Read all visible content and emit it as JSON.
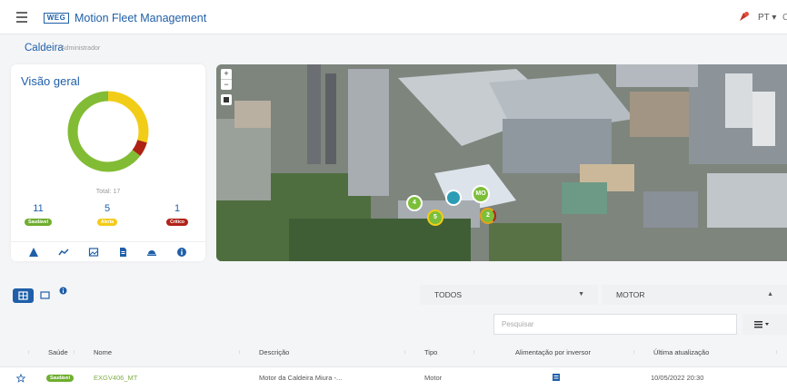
{
  "header": {
    "logo_text": "WEG",
    "title": "Motion Fleet Management",
    "language": "PT ▾",
    "user_initial": "C"
  },
  "breadcrumb": {
    "title": "Caldeira",
    "subtitle": "Administrador"
  },
  "overview": {
    "title": "Visão geral",
    "total_label": "Total: 17",
    "chart_data": {
      "type": "pie",
      "categories": [
        "Saudável",
        "Alerta",
        "Crítico"
      ],
      "values": [
        11,
        5,
        1
      ],
      "colors": [
        "#82bc34",
        "#f2cd18",
        "#ad2215"
      ]
    },
    "stats": [
      {
        "count": "11",
        "label": "Saudável",
        "color": "#6fae2f"
      },
      {
        "count": "5",
        "label": "Alerta",
        "color": "#f3cb19"
      },
      {
        "count": "1",
        "label": "Crítico",
        "color": "#b22218"
      }
    ],
    "tools": [
      "warning-icon",
      "trend-icon",
      "image-icon",
      "document-icon",
      "motor-icon",
      "info-icon"
    ]
  },
  "map": {
    "zoom_in": "+",
    "zoom_out": "−",
    "markers": [
      {
        "label": "4",
        "color": "#7cbf39"
      },
      {
        "label": "",
        "color": "#2a9db5"
      },
      {
        "label": "MO",
        "color": "#7cbf39"
      },
      {
        "label": "5",
        "color": "#7cbf39"
      },
      {
        "label": "2",
        "color": "#7cbf39"
      }
    ]
  },
  "filters": {
    "group_select": "TODOS",
    "type_select": "MOTOR",
    "search_placeholder": "Pesquisar"
  },
  "table": {
    "headers": [
      "Saúde",
      "Nome",
      "Descrição",
      "Tipo",
      "Alimentação por inversor",
      "Última atualização"
    ],
    "rows": [
      {
        "health": "Saudável",
        "name": "EXGV406_MT",
        "description": "Motor da Caldeira Miura -...",
        "type": "Motor",
        "updated": "10/05/2022 20:30"
      }
    ]
  },
  "colors": {
    "primary": "#1f5fa8",
    "link": "#7fae4a"
  }
}
